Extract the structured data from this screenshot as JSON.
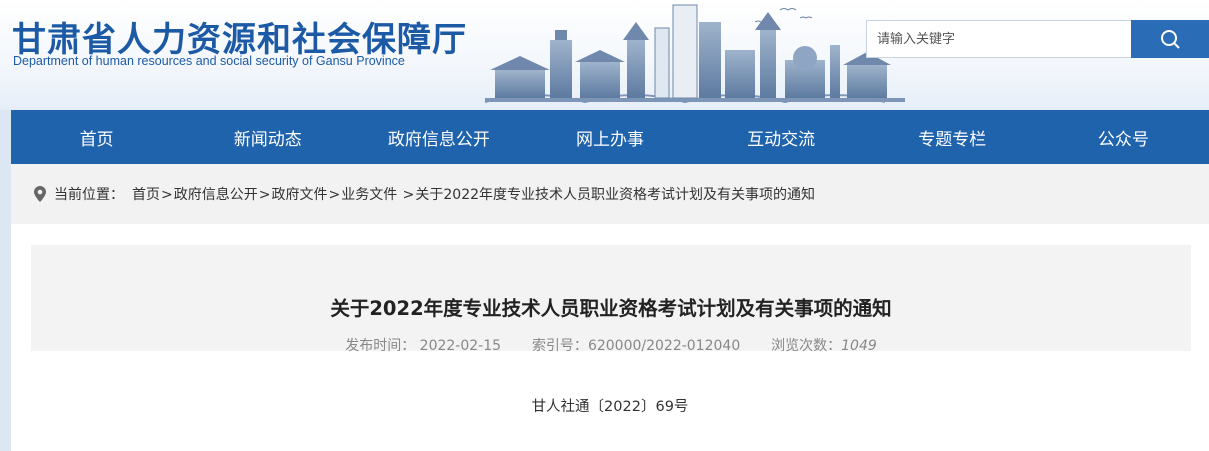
{
  "header": {
    "title": "甘肃省人力资源和社会保障厅",
    "subtitle": "Department of human resources and social security of Gansu Province"
  },
  "search": {
    "placeholder": "请输入关键字",
    "button_icon": "search-icon"
  },
  "nav": {
    "items": [
      "首页",
      "新闻动态",
      "政府信息公开",
      "网上办事",
      "互动交流",
      "专题专栏",
      "公众号"
    ]
  },
  "breadcrumb": {
    "icon": "location-pin-icon",
    "label": "当前位置：",
    "items": [
      "首页",
      "政府信息公开",
      "政府文件",
      "业务文件",
      "关于2022年度专业技术人员职业资格考试计划及有关事项的通知"
    ]
  },
  "article": {
    "title": "关于2022年度专业技术人员职业资格考试计划及有关事项的通知",
    "publish_label": "发布时间：",
    "publish_date": "2022-02-15",
    "index_label": "索引号：",
    "index_no": "620000/2022-012040",
    "views_label": "浏览次数：",
    "views": "1049",
    "doc_number": "甘人社通〔2022〕69号"
  },
  "colors": {
    "brand_blue": "#1f63ad",
    "title_blue": "#1d5aa6"
  }
}
